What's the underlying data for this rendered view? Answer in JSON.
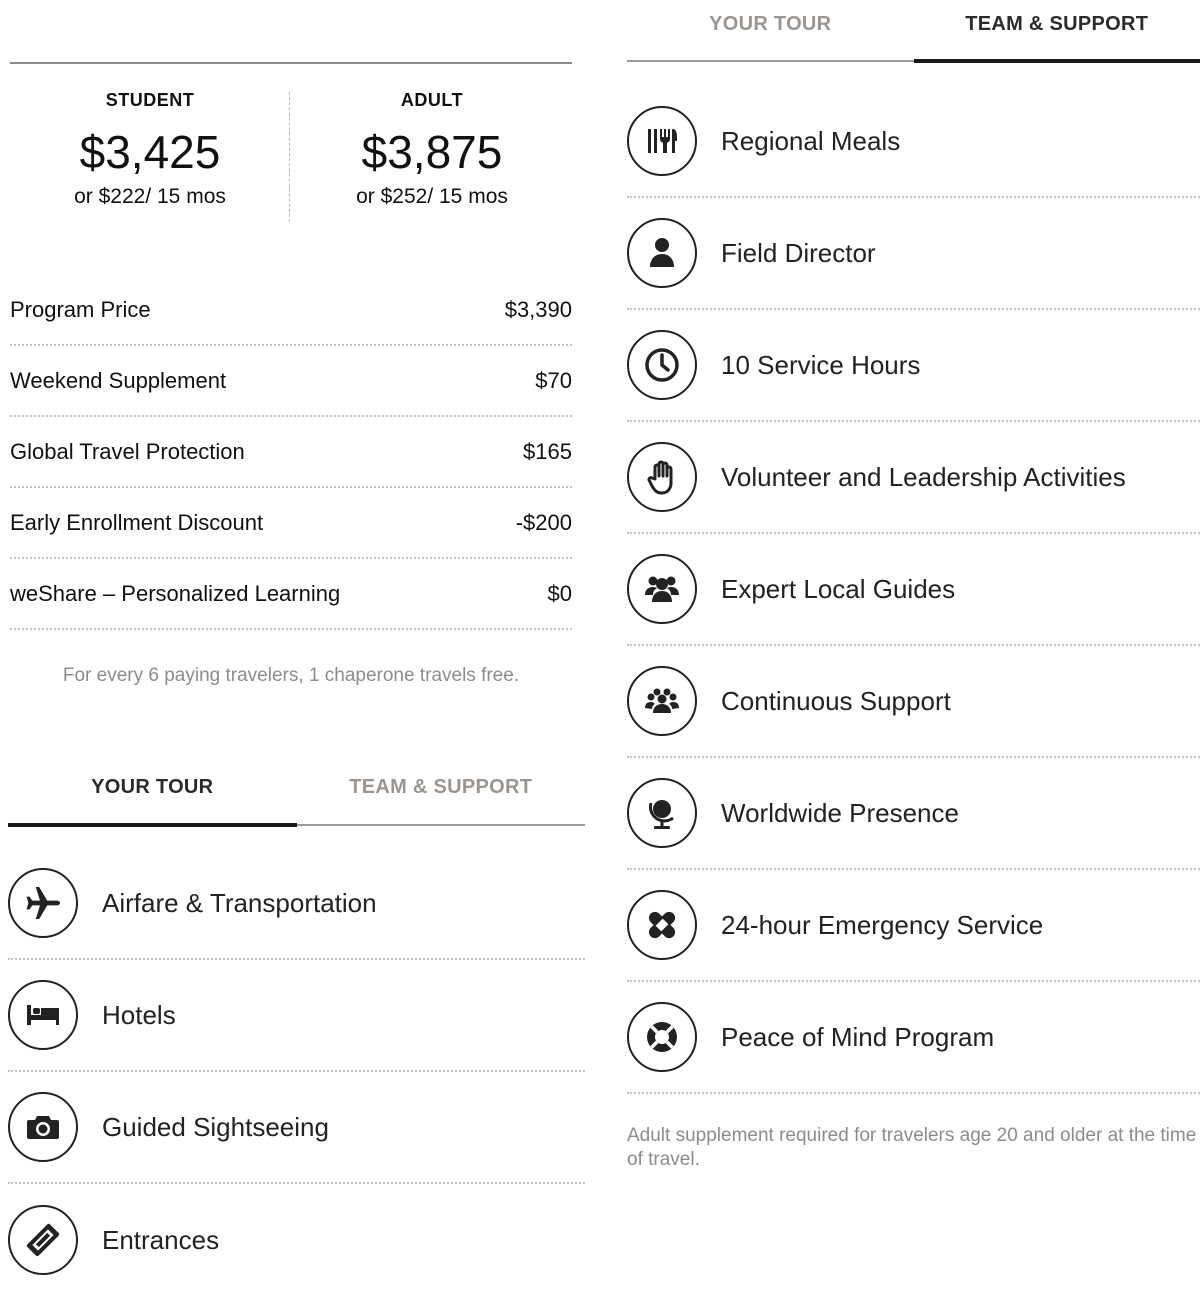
{
  "pricing": {
    "student": {
      "label": "STUDENT",
      "amount": "$3,425",
      "monthly": "or $222/ 15 mos"
    },
    "adult": {
      "label": "ADULT",
      "amount": "$3,875",
      "monthly": "or $252/ 15 mos"
    }
  },
  "price_breakdown": [
    {
      "label": "Program Price",
      "value": "$3,390"
    },
    {
      "label": "Weekend Supplement",
      "value": "$70"
    },
    {
      "label": "Global Travel Protection",
      "value": "$165"
    },
    {
      "label": "Early Enrollment Discount",
      "value": "-$200"
    },
    {
      "label": "weShare – Personalized Learning",
      "value": "$0"
    }
  ],
  "chaperone_note": "For every 6 paying travelers, 1 chaperone travels free.",
  "tabs": {
    "your_tour": "YOUR TOUR",
    "team_support": "TEAM & SUPPORT"
  },
  "your_tour_items": [
    {
      "label": "Airfare & Transportation",
      "icon": "airplane-icon"
    },
    {
      "label": "Hotels",
      "icon": "bed-icon"
    },
    {
      "label": "Guided Sightseeing",
      "icon": "camera-icon"
    },
    {
      "label": "Entrances",
      "icon": "ticket-icon"
    }
  ],
  "team_support_items": [
    {
      "label": "Regional Meals",
      "icon": "utensils-icon"
    },
    {
      "label": "Field Director",
      "icon": "person-icon"
    },
    {
      "label": "10 Service Hours",
      "icon": "clock-icon"
    },
    {
      "label": "Volunteer and Leadership Activities",
      "icon": "hand-icon"
    },
    {
      "label": "Expert Local Guides",
      "icon": "group-icon"
    },
    {
      "label": "Continuous Support",
      "icon": "crowd-icon"
    },
    {
      "label": "Worldwide Presence",
      "icon": "globe-icon"
    },
    {
      "label": "24-hour Emergency Service",
      "icon": "bandage-icon"
    },
    {
      "label": "Peace of Mind Program",
      "icon": "lifebuoy-icon"
    }
  ],
  "footnote": "Adult supplement required for travelers age 20 and older at the time of travel."
}
